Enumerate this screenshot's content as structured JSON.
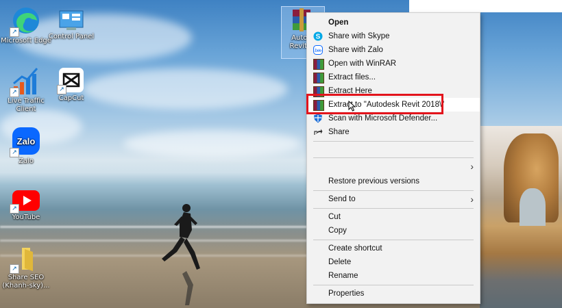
{
  "desktop": {
    "icons": [
      {
        "label": "Microsoft Edge",
        "name": "microsoft-edge-icon"
      },
      {
        "label": "Control Panel",
        "name": "control-panel-icon"
      },
      {
        "label": "Live Traffic Client",
        "name": "live-traffic-client-icon"
      },
      {
        "label": "CapCut",
        "name": "capcut-icon"
      },
      {
        "label": "Zalo",
        "name": "zalo-icon"
      },
      {
        "label": "YouTube",
        "name": "youtube-icon"
      },
      {
        "label": "Share SEO (Khanh-sky)...",
        "name": "share-seo-folder-icon"
      }
    ],
    "selected_file": {
      "label_line1": "Autod",
      "label_line2": "Revit 2",
      "name": "winrar-archive-icon"
    }
  },
  "context_menu": {
    "items": [
      {
        "label": "Open",
        "icon": "none",
        "bold": true
      },
      {
        "label": "Share with Skype",
        "icon": "skype-icon"
      },
      {
        "label": "Share with Zalo",
        "icon": "zalo-icon"
      },
      {
        "label": "Open with WinRAR",
        "icon": "winrar-icon"
      },
      {
        "label": "Extract files...",
        "icon": "winrar-icon"
      },
      {
        "label": "Extract Here",
        "icon": "winrar-icon"
      },
      {
        "label": "Extract to \"Autodesk Revit 2018\\\"",
        "icon": "winrar-icon"
      },
      {
        "label": "Scan with Microsoft Defender...",
        "icon": "defender-shield-icon"
      },
      {
        "label": "Share",
        "icon": "share-icon"
      },
      {
        "label": "Restore previous versions"
      },
      {
        "label": "Send to"
      },
      {
        "label": "Cut"
      },
      {
        "label": "Copy"
      },
      {
        "label": "Create shortcut"
      },
      {
        "label": "Delete"
      },
      {
        "label": "Rename"
      },
      {
        "label": "Properties"
      }
    ]
  },
  "colors": {
    "highlight_box": "#e3141c",
    "menu_bg": "#f2f2f2"
  }
}
